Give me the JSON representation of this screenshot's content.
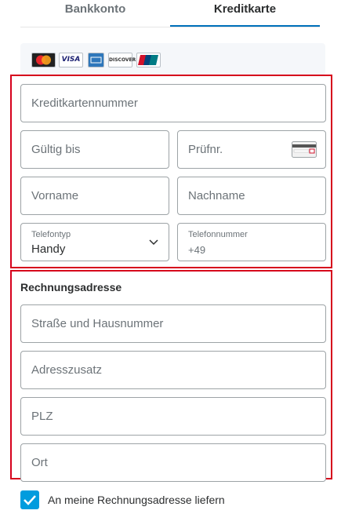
{
  "tabs": {
    "bank": "Bankkonto",
    "card": "Kreditkarte"
  },
  "card_brands": [
    {
      "icon": "mastercard-icon",
      "label": "MasterCard",
      "color": "#e8262c"
    },
    {
      "icon": "visa-icon",
      "label": "VISA",
      "color": "#1a1f71"
    },
    {
      "icon": "amex-icon",
      "label": "AMEX",
      "color": "#2e77bb"
    },
    {
      "icon": "discover-icon",
      "label": "DISCOVER",
      "color": "#f58220"
    },
    {
      "icon": "unionpay-icon",
      "label": "UnionPay",
      "color": "#d0112b"
    }
  ],
  "card_form": {
    "card_number_placeholder": "Kreditkartennummer",
    "expiry_placeholder": "Gültig bis",
    "cvv_placeholder": "Prüfnr.",
    "first_name_placeholder": "Vorname",
    "last_name_placeholder": "Nachname",
    "phone_type_label": "Telefontyp",
    "phone_type_value": "Handy",
    "phone_number_label": "Telefonnummer",
    "phone_number_value": "+49"
  },
  "billing": {
    "title": "Rechnungsadresse",
    "street_placeholder": "Straße und Hausnummer",
    "address2_placeholder": "Adresszusatz",
    "zip_placeholder": "PLZ",
    "city_placeholder": "Ort"
  },
  "shipping_checkbox": {
    "label": "An meine Rechnungsadresse liefern",
    "checked": true
  },
  "colors": {
    "accent": "#0070ba",
    "highlight": "#d6001c",
    "checkbox": "#009cde"
  }
}
